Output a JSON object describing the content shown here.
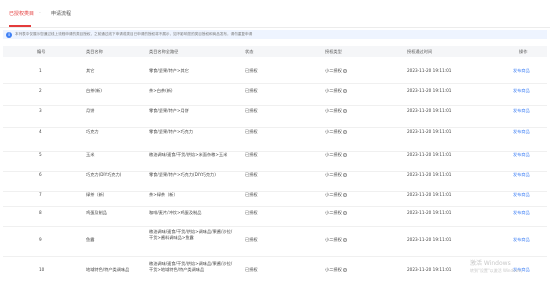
{
  "tabs": {
    "active": "已授权类目",
    "other": "申请流程"
  },
  "notice": {
    "icon": "info-icon",
    "text": "本列表中仅展示您通过线上流程申请的类目授权，之前通过线下申请或类目已申请的授权将不展示，如不影响您的类目授权和商品发布，请勿重复申请"
  },
  "table": {
    "headers": [
      "编号",
      "类目名称",
      "类目名称全路径",
      "状态",
      "授权类型",
      "授权通过时间",
      "操作"
    ],
    "rows": [
      {
        "no": "1",
        "name": "其它",
        "path": "零食/坚果/特产>其它",
        "status": "已授权",
        "type": "小二授权",
        "time": "2023-11-20 19:11:01",
        "op": "发布商品"
      },
      {
        "no": "2",
        "name": "白茶(新)",
        "path": "茶>白茶(新)",
        "status": "已授权",
        "type": "小二授权",
        "time": "2023-11-20 19:11:01",
        "op": "发布商品"
      },
      {
        "no": "3",
        "name": "月饼",
        "path": "零食/坚果/特产>月饼",
        "status": "已授权",
        "type": "小二授权",
        "time": "2023-11-20 19:11:01",
        "op": "发布商品"
      },
      {
        "no": "4",
        "name": "巧克力",
        "path": "零食/坚果/特产>巧克力",
        "status": "已授权",
        "type": "小二授权",
        "time": "2023-11-20 19:11:01",
        "op": "发布商品"
      },
      {
        "no": "5",
        "name": "玉米",
        "path": "粮油调味/速食/干货/烘焙>米面杂粮>玉米",
        "status": "已授权",
        "type": "小二授权",
        "time": "2023-11-20 19:11:01",
        "op": "发布商品"
      },
      {
        "no": "6",
        "name": "巧克力(DIY巧克力)",
        "path": "零食/坚果/特产>巧克力(DIY巧克力)",
        "status": "已授权",
        "type": "小二授权",
        "time": "2023-11-20 19:11:01",
        "op": "发布商品"
      },
      {
        "no": "7",
        "name": "绿茶（新）",
        "path": "茶>绿茶（新）",
        "status": "已授权",
        "type": "小二授权",
        "time": "2023-11-20 19:11:01",
        "op": "发布商品"
      },
      {
        "no": "8",
        "name": "鸡蛋及制品",
        "path": "咖啡/麦片/冲饮>鸡蛋及制品",
        "status": "已授权",
        "type": "小二授权",
        "time": "2023-11-20 19:11:01",
        "op": "发布商品"
      },
      {
        "no": "9",
        "name": "鱼露",
        "path": "粮油调味/速食/干货/烘焙>调味品/果酱/沙拉/干货>酱料调味品>鱼露",
        "status": "已授权",
        "type": "小二授权",
        "time": "2023-11-20 19:11:01",
        "op": "发布商品"
      },
      {
        "no": "10",
        "name": "地域特色/特产类调味品",
        "path": "粮油调味/速食/干货/烘焙>调味品/果酱/沙拉/干货>地域特色/特产类调味品",
        "status": "已授权",
        "type": "小二授权",
        "time": "2023-11-20 19:11:01",
        "op": "发布商品"
      }
    ]
  },
  "watermark": {
    "line1": "激活 Windows",
    "line2": "转到\"设置\"以激活 Windows。"
  }
}
